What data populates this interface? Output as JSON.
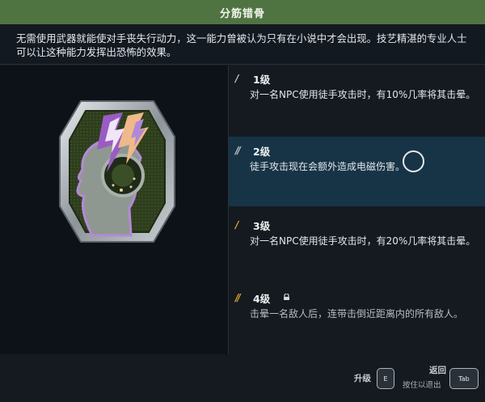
{
  "title": "分筋错骨",
  "description": "无需使用武器就能使对手丧失行动力，这一能力曾被认为只有在小说中才会出现。技艺精湛的专业人士可以让这种能力发挥出恐怖的效果。",
  "levels": [
    {
      "title": "1级",
      "text": "对一名NPC使用徒手攻击时，有10%几率将其击晕。",
      "pips_filled": 1,
      "pips_total": 1,
      "active": false,
      "locked": false
    },
    {
      "title": "2级",
      "text": "徒手攻击现在会额外造成电磁伤害。",
      "pips_filled": 0,
      "pips_total": 2,
      "active": true,
      "locked": false
    },
    {
      "title": "3级",
      "text": "对一名NPC使用徒手攻击时，有20%几率将其击晕。",
      "pips_filled": 1,
      "pips_total": 1,
      "active": false,
      "locked": false
    },
    {
      "title": "4级",
      "text": "击晕一名敌人后，连带击倒近距离内的所有敌人。",
      "pips_filled": 2,
      "pips_total": 2,
      "active": false,
      "locked": true
    }
  ],
  "footer": {
    "upgrade_label": "升级",
    "upgrade_key": "E",
    "back_label": "返回",
    "exit_label": "按住以退出",
    "back_key": "Tab"
  },
  "colors": {
    "title_bar": "#4f7442",
    "accent": "#e3a32e",
    "active_row": "#173446",
    "badge_purple": "#9a5cc4"
  },
  "icons": {
    "badge": "brain-lightning-badge-icon",
    "lock": "lock-icon",
    "cursor": "cursor-circle-icon"
  }
}
